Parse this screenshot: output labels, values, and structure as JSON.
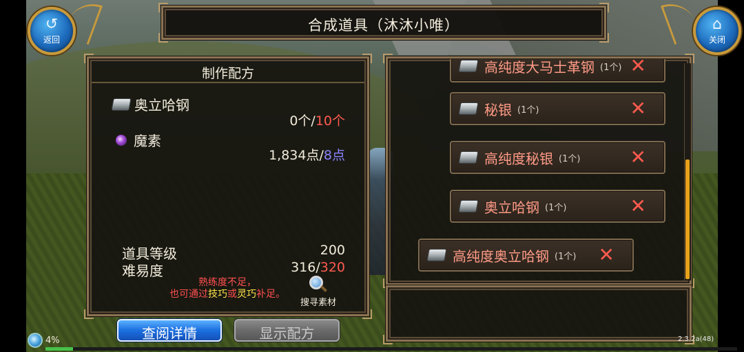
{
  "window": {
    "title": "合成道具（沐沐小唯）",
    "back_label": "返回",
    "close_label": "关闭",
    "back_icon": "undo-arrow-icon",
    "close_icon": "home-icon"
  },
  "recipe": {
    "header": "制作配方",
    "ingredients": [
      {
        "icon": "ingot-icon",
        "name": "奥立哈钢",
        "have": "0个",
        "slash": "/",
        "need": "10个"
      },
      {
        "icon": "purple-orb-icon",
        "name": "魔素",
        "have": "1,834点",
        "slash": "/",
        "need": "8点"
      }
    ],
    "stats": [
      {
        "label": "道具等级",
        "value": "200",
        "value_suffix": ""
      },
      {
        "label": "难易度",
        "value": "316/",
        "value_suffix": "320"
      }
    ],
    "warning": {
      "line1": "熟练度不足，",
      "line2_pre": "也可通过",
      "line2_skill1": "技巧",
      "line2_mid": "或",
      "line2_skill2": "灵巧",
      "line2_post": "补足。"
    },
    "search_label": "搜寻素材"
  },
  "buttons": {
    "details": "查阅详情",
    "show_recipe": "显示配方"
  },
  "material_list": [
    {
      "name": "高纯度大马士革钢",
      "count": "(1个)"
    },
    {
      "name": "秘银",
      "count": "(1个)"
    },
    {
      "name": "高纯度秘银",
      "count": "(1个)"
    },
    {
      "name": "奥立哈钢",
      "count": "(1个)"
    },
    {
      "name": "高纯度奥立哈钢",
      "count": "(1个)"
    }
  ],
  "remove_glyph": "✕",
  "status": {
    "percent": "4%",
    "version": "2.3.2a(48)",
    "exp_fraction": 0.04
  },
  "colors": {
    "need_red": "#ff5a4f",
    "need_blue": "#8b84ff",
    "item_name": "#ff9a86",
    "warn_red": "#ff4f4f",
    "warn_yellow": "#ffe34a",
    "frame_gold": "#8a7252",
    "button_blue": "#1c6fe0",
    "scroll_thumb": "#e7a21a"
  }
}
